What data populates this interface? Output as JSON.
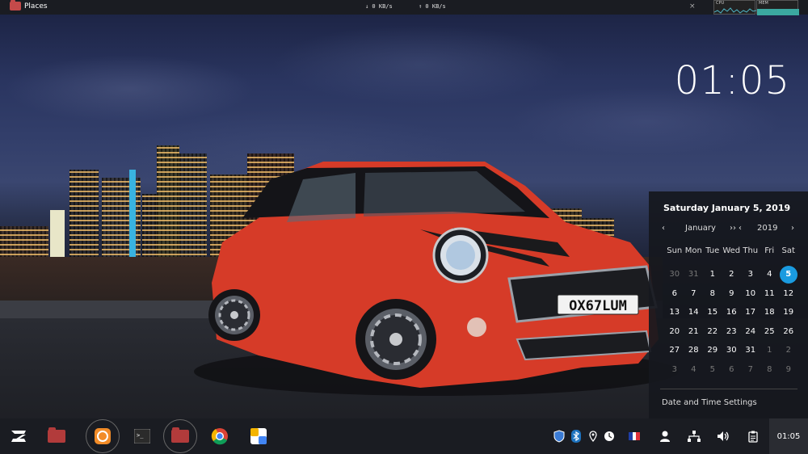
{
  "topbar": {
    "places_label": "Places",
    "down_speed": "↓ 0 KB/s",
    "up_speed": "↑ 0 KB/s",
    "close_glyph": "×",
    "cpu_label": "CPU",
    "mem_label": "MEM"
  },
  "desktop": {
    "clock": "01:05"
  },
  "wallpaper": {
    "plate": "OX67LUM"
  },
  "calendar": {
    "full_date": "Saturday January 5, 2019",
    "month": "January",
    "year": "2019",
    "prev_glyph": "‹",
    "next_glyph": "››",
    "year_prev_glyph": "‹",
    "year_next_glyph": "›",
    "weekdays": [
      "Sun",
      "Mon",
      "Tue",
      "Wed",
      "Thu",
      "Fri",
      "Sat"
    ],
    "weeks": [
      [
        "30",
        "31",
        "1",
        "2",
        "3",
        "4",
        "5"
      ],
      [
        "6",
        "7",
        "8",
        "9",
        "10",
        "11",
        "12"
      ],
      [
        "13",
        "14",
        "15",
        "16",
        "17",
        "18",
        "19"
      ],
      [
        "20",
        "21",
        "22",
        "23",
        "24",
        "25",
        "26"
      ],
      [
        "27",
        "28",
        "29",
        "30",
        "31",
        "1",
        "2"
      ],
      [
        "3",
        "4",
        "5",
        "6",
        "7",
        "8",
        "9"
      ]
    ],
    "settings_label": "Date and Time Settings"
  },
  "taskbar": {
    "clock": "01:05",
    "apps": [
      "zorin-menu",
      "files",
      "software",
      "terminal",
      "files",
      "chrome",
      "store"
    ],
    "tray": [
      "shield",
      "bluetooth",
      "location",
      "clock",
      "flag-fr",
      "user",
      "network",
      "volume",
      "clipboard"
    ]
  },
  "colors": {
    "accent": "#1a9be0",
    "panel": "#1a1c22",
    "folder": "#b23b3b",
    "car": "#d63b28"
  }
}
